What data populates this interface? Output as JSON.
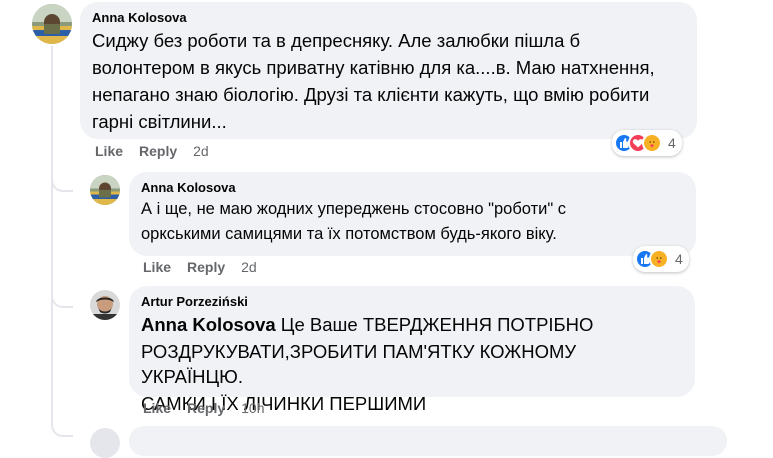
{
  "comments": [
    {
      "author": "Anna Kolosova",
      "text": "Сиджу без роботи та в депресняку. Але залюбки пішла б волонтером в якусь приватну катівню для ка....в. Маю натхнення, непагано знаю біологію. Друзі та клієнти кажуть, що вмію робити гарні світлини...",
      "line1": "Сиджу без роботи та в депресняку. Але залюбки пішла б",
      "line2": "волонтером в якусь приватну катівню для ка....в. Маю натхнення,",
      "line3": "непагано знаю біологію. Друзі та клієнти кажуть, що вмію робити",
      "line4": "гарні світлини...",
      "like": "Like",
      "reply": "Reply",
      "time": "2d",
      "reaction_count": "4",
      "reactions": [
        "like-icon",
        "love-icon",
        "care-icon"
      ]
    },
    {
      "author": "Anna Kolosova",
      "line1": "А і ще, не маю жодних упереджень стосовно \"роботи\" с",
      "line2": "оркськими самицями та їх потомством будь-якого віку.",
      "like": "Like",
      "reply": "Reply",
      "time": "2d",
      "reaction_count": "4",
      "reactions": [
        "like-icon",
        "care-icon"
      ]
    },
    {
      "author": "Artur Porzeziński",
      "mention": "Anna Kolosova",
      "line1_rest": " Це Ваше ТВЕРДЖЕННЯ ПОТРІБНО",
      "line2": "РОЗДРУКУВАТИ,ЗРОБИТИ ПАМ'ЯТКУ КОЖНОМУ УКРАЇНЦЮ.",
      "line3": "САМКИ І ЇХ ЛІЧИНКИ ПЕРШИМИ",
      "like": "Like",
      "reply": "Reply",
      "time": "10h"
    }
  ],
  "colors": {
    "bubble": "#f0f2f5",
    "meta": "#65676b",
    "like": "#1877f2",
    "love": "#f33e58",
    "care": "#f7b125"
  }
}
